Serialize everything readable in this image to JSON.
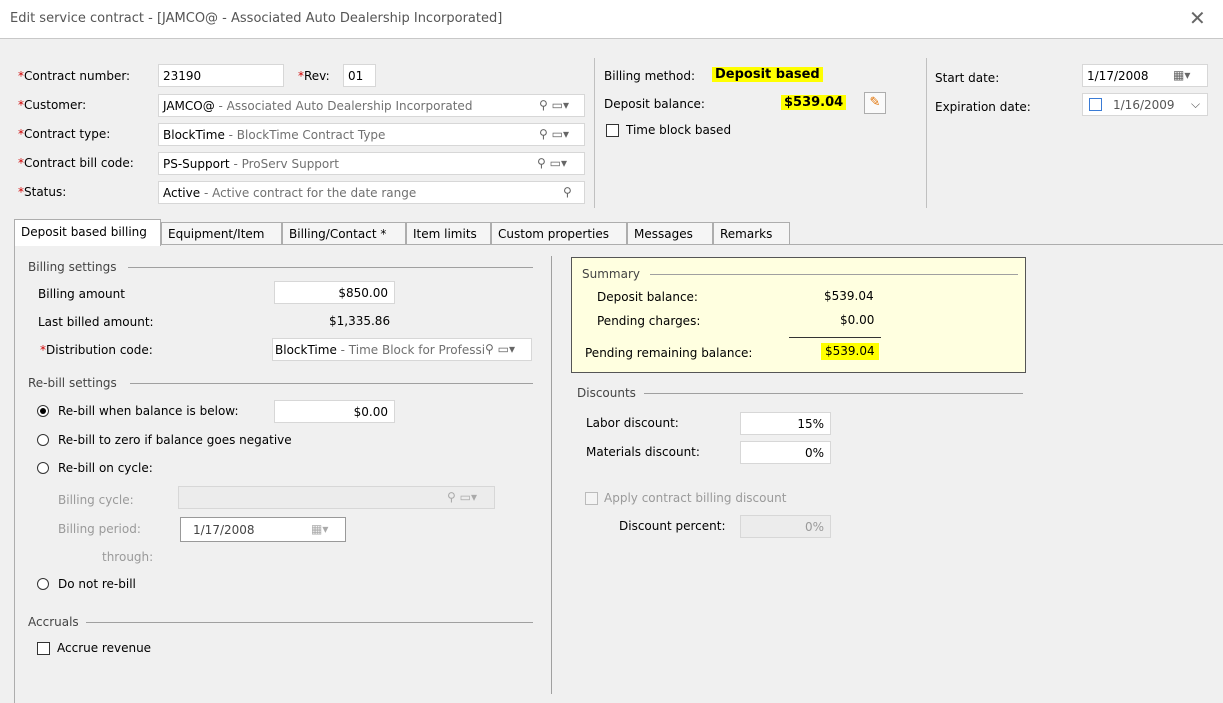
{
  "window": {
    "title": "Edit service contract - [JAMCO@ - Associated Auto Dealership Incorporated]",
    "close_glyph": "✕"
  },
  "header": {
    "contract_number_label": "Contract number:",
    "contract_number": "23190",
    "rev_label": "Rev:",
    "rev": "01",
    "customer_label": "Customer:",
    "customer_code": "JAMCO@",
    "customer_desc": " - Associated Auto Dealership Incorporated",
    "contract_type_label": "Contract type:",
    "contract_type_code": "BlockTime",
    "contract_type_desc": " - BlockTime Contract Type",
    "bill_code_label": "Contract bill code:",
    "bill_code_code": "PS-Support",
    "bill_code_desc": " - ProServ Support",
    "status_label": "Status:",
    "status_code": "Active",
    "status_desc": " - Active contract for the date range",
    "required_mark": "*",
    "billing_method_label": "Billing method:",
    "billing_method": "Deposit based",
    "deposit_balance_label": "Deposit balance:",
    "deposit_balance": "$539.04",
    "time_block_label": "Time block based",
    "start_date_label": "Start date:",
    "start_date": "1/17/2008",
    "expiration_date_label": "Expiration date:",
    "expiration_date": "1/16/2009",
    "highlight_color": "#ffff00"
  },
  "tabs": [
    {
      "label": "Deposit based billing"
    },
    {
      "label": "Equipment/Item"
    },
    {
      "label": "Billing/Contact *"
    },
    {
      "label": "Item limits"
    },
    {
      "label": "Custom properties"
    },
    {
      "label": "Messages"
    },
    {
      "label": "Remarks"
    }
  ],
  "billing_settings": {
    "title": "Billing settings",
    "billing_amount_label": "Billing amount",
    "billing_amount": "$850.00",
    "last_billed_label": "Last billed amount:",
    "last_billed": "$1,335.86",
    "distribution_label": "Distribution code:",
    "distribution_code": "BlockTime",
    "distribution_desc": " - Time Block for Professic"
  },
  "rebill": {
    "title": "Re-bill settings",
    "opt_below_label": "Re-bill when balance is below:",
    "below_value": "$0.00",
    "opt_zero_label": "Re-bill to zero if balance goes negative",
    "opt_cycle_label": "Re-bill on cycle:",
    "billing_cycle_label": "Billing cycle:",
    "billing_period_label": "Billing period:",
    "billing_period": "1/17/2008",
    "through_label": "through:",
    "opt_none_label": "Do not re-bill",
    "selected": "below"
  },
  "accruals": {
    "title": "Accruals",
    "accrue_label": "Accrue revenue"
  },
  "summary": {
    "title": "Summary",
    "deposit_balance_label": "Deposit balance:",
    "deposit_balance": "$539.04",
    "pending_charges_label": "Pending charges:",
    "pending_charges": "$0.00",
    "remaining_label": "Pending remaining balance:",
    "remaining": "$539.04",
    "background": "#ffffe0"
  },
  "discounts": {
    "title": "Discounts",
    "labor_label": "Labor discount:",
    "labor": "15%",
    "materials_label": "Materials discount:",
    "materials": "0%",
    "apply_label": "Apply contract billing discount",
    "percent_label": "Discount percent:",
    "percent": "0%"
  }
}
